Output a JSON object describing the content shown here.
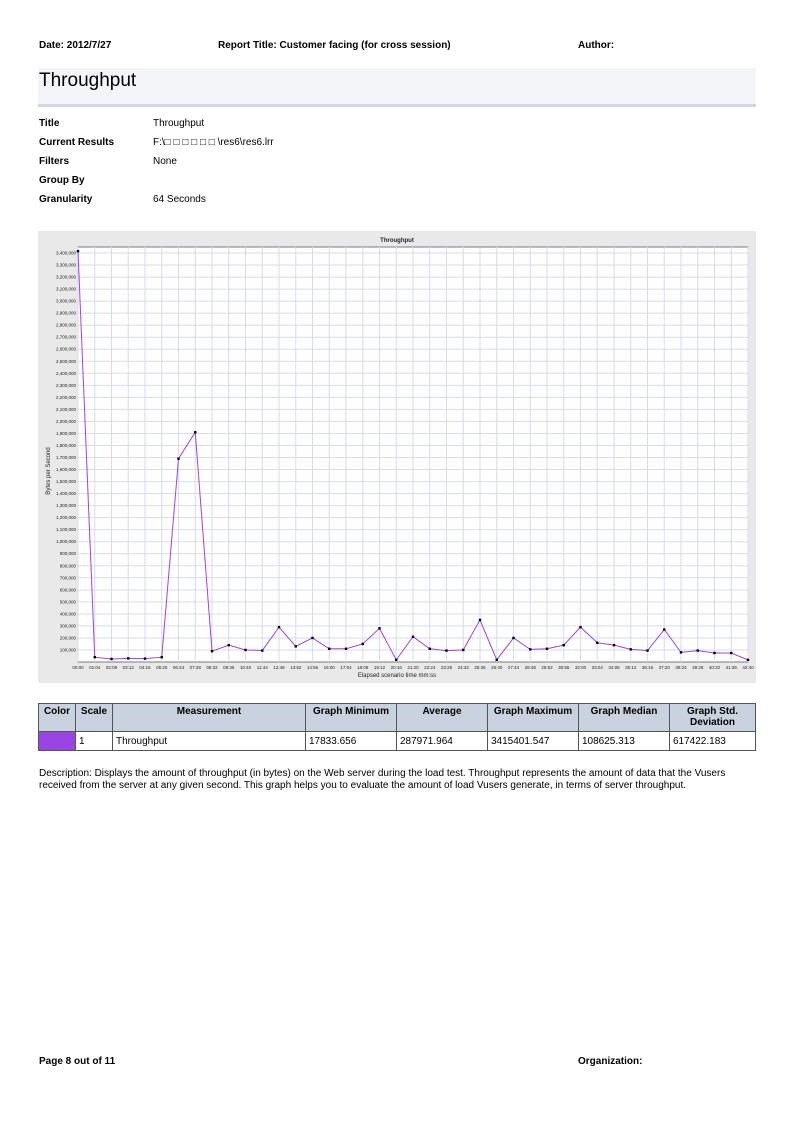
{
  "header": {
    "date": "Date: 2012/7/27",
    "report_title": "Report Title: Customer facing (for cross session)",
    "author": "Author:"
  },
  "page_title": "Throughput",
  "properties": [
    {
      "label": "Title",
      "value": "Throughput"
    },
    {
      "label": "Current Results",
      "value": "F:\\□ □ □ □ □ □ \\res6\\res6.lrr"
    },
    {
      "label": "Filters",
      "value": "None"
    },
    {
      "label": "Group By",
      "value": ""
    },
    {
      "label": "Granularity",
      "value": "64 Seconds"
    }
  ],
  "chart_data": {
    "type": "line",
    "title": "Throughput",
    "xlabel": "Elapsed scenario time mm:ss",
    "ylabel": "Bytes per Second",
    "ylim": [
      0,
      3450000
    ],
    "grid": true,
    "series_color": "#9a44e6",
    "x_ticks": [
      "00:00",
      "01:04",
      "02:08",
      "03:12",
      "04:16",
      "05:20",
      "06:24",
      "07:28",
      "08:32",
      "09:36",
      "10:40",
      "11:44",
      "12:48",
      "13:52",
      "14:56",
      "16:00",
      "17:04",
      "18:08",
      "19:12",
      "20:16",
      "21:20",
      "22:24",
      "23:28",
      "24:32",
      "25:36",
      "26:40",
      "27:44",
      "28:48",
      "29:52",
      "30:56",
      "32:00",
      "33:04",
      "34:08",
      "35:12",
      "36:16",
      "37:20",
      "38:24",
      "39:28",
      "40:32",
      "41:36",
      "42:40"
    ],
    "y_ticks": [
      "100,000",
      "200,000",
      "300,000",
      "400,000",
      "500,000",
      "600,000",
      "700,000",
      "800,000",
      "900,000",
      "1,000,000",
      "1,100,000",
      "1,200,000",
      "1,300,000",
      "1,400,000",
      "1,500,000",
      "1,600,000",
      "1,700,000",
      "1,800,000",
      "1,900,000",
      "2,000,000",
      "2,100,000",
      "2,200,000",
      "2,300,000",
      "2,400,000",
      "2,500,000",
      "2,600,000",
      "2,700,000",
      "2,800,000",
      "2,900,000",
      "3,000,000",
      "3,100,000",
      "3,200,000",
      "3,300,000",
      "3,400,000"
    ],
    "series": [
      {
        "name": "Throughput",
        "x": [
          "00:00",
          "01:04",
          "02:08",
          "03:12",
          "04:16",
          "05:20",
          "06:24",
          "07:28",
          "08:32",
          "09:36",
          "10:40",
          "11:44",
          "12:48",
          "13:52",
          "14:56",
          "16:00",
          "17:04",
          "18:08",
          "19:12",
          "20:16",
          "21:20",
          "22:24",
          "23:28",
          "24:32",
          "25:36",
          "26:40",
          "27:44",
          "28:48",
          "29:52",
          "30:56",
          "32:00",
          "33:04",
          "34:08",
          "35:12",
          "36:16",
          "37:20",
          "38:24",
          "39:28",
          "40:32",
          "41:36",
          "42:40"
        ],
        "values": [
          3415400,
          40000,
          25000,
          30000,
          28000,
          40000,
          1690000,
          1910000,
          90000,
          140000,
          100000,
          95000,
          290000,
          130000,
          200000,
          110000,
          110000,
          150000,
          280000,
          17800,
          210000,
          110000,
          95000,
          100000,
          350000,
          17800,
          200000,
          105000,
          110000,
          140000,
          290000,
          160000,
          140000,
          105000,
          95000,
          270000,
          80000,
          95000,
          75000,
          75000,
          17800
        ]
      }
    ]
  },
  "stats_table": {
    "headers": [
      "Color",
      "Scale",
      "Measurement",
      "Graph Minimum",
      "Average",
      "Graph Maximum",
      "Graph Median",
      "Graph Std. Deviation"
    ],
    "row": {
      "color": "#9a44e6",
      "scale": "1",
      "measurement": "Throughput",
      "min": "17833.656",
      "avg": "287971.964",
      "max": "3415401.547",
      "median": "108625.313",
      "std": "617422.183"
    }
  },
  "description": "Description: Displays the amount of throughput (in bytes) on the Web server during the load test. Throughput represents the amount of data that the Vusers received from the server at any given second. This graph helps you to evaluate the amount of load Vusers generate, in terms of server throughput.",
  "footer": {
    "page": "Page 8 out of  11",
    "organization": "Organization:"
  }
}
